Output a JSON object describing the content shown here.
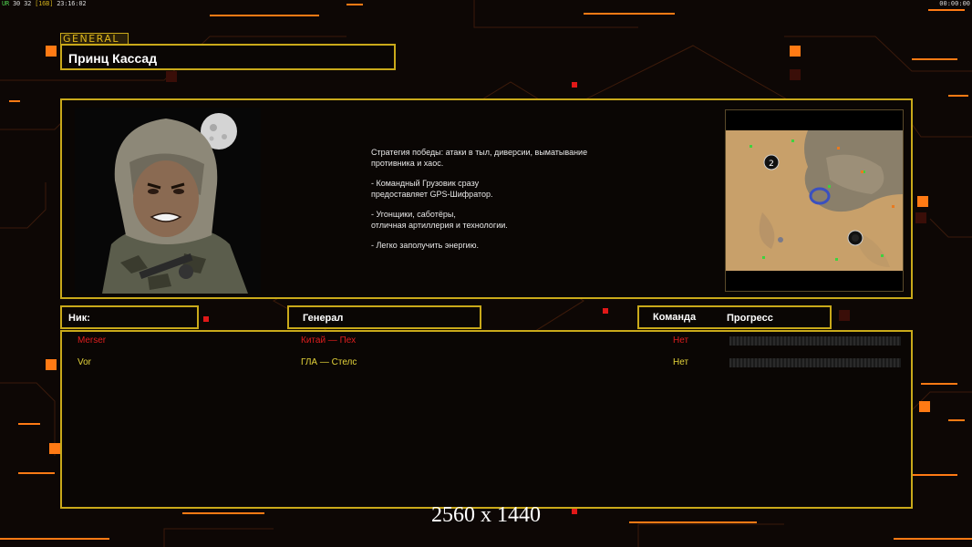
{
  "hud": {
    "left_prefix": "UR",
    "left_values": "30 32",
    "left_bracket": "[16B]",
    "left_time": "23:16:02",
    "right_time": "00:00:00"
  },
  "general_tab": "GENERAL",
  "general_name": "Принц Кассад",
  "description": [
    "Стратегия победы: атаки в тыл, диверсии, выматывание\n противника и хаос.",
    "- Командный Грузовик сразу\nпредоставляет GPS-Шифратор.",
    "- Угонщики, саботёры,\nотличная артиллерия и технологии.",
    "- Легко заполучить энергию."
  ],
  "minimap": {
    "marker_label": "2"
  },
  "headers": {
    "nick": "Ник:",
    "general": "Генерал",
    "team": "Команда",
    "progress": "Прогресс"
  },
  "players": [
    {
      "nick": "Merser",
      "general": "Китай — Пех",
      "team": "Нет",
      "progress": 0,
      "color": "#e01e1e"
    },
    {
      "nick": "Vor",
      "general": "ГЛА — Стелс",
      "team": "Нет",
      "progress": 0,
      "color": "#e3d23a"
    }
  ],
  "colors": {
    "accent": "#c9a91a",
    "orange": "#ff7a14"
  },
  "resolution_caption": "2560 x 1440"
}
